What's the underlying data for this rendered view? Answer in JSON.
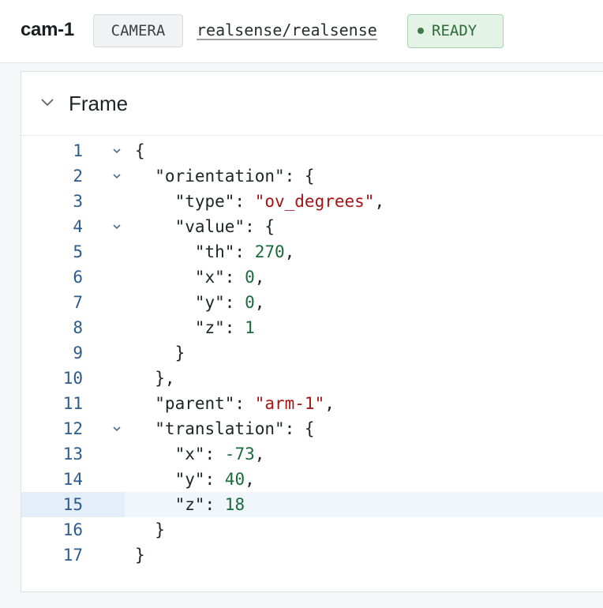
{
  "header": {
    "title": "cam-1",
    "type_label": "CAMERA",
    "model_label": "realsense/realsense",
    "status_label": "READY"
  },
  "panel": {
    "title": "Frame",
    "collapse_icon": "chevron-down-icon"
  },
  "colors": {
    "status_bg": "#e3f3e5",
    "status_text": "#2f6b3a",
    "line_number": "#2d5b8c",
    "string": "#a31515",
    "number": "#1a6b3c",
    "active_line": "#f0f6fc"
  },
  "editor": {
    "active_line": 15,
    "lines": [
      {
        "n": "1",
        "fold": true,
        "tokens": [
          {
            "t": "p",
            "v": "{"
          }
        ]
      },
      {
        "n": "2",
        "fold": true,
        "tokens": [
          {
            "t": "p",
            "v": "  \"orientation\": {"
          }
        ]
      },
      {
        "n": "3",
        "fold": false,
        "tokens": [
          {
            "t": "p",
            "v": "    \"type\": "
          },
          {
            "t": "s",
            "v": "\"ov_degrees\""
          },
          {
            "t": "p",
            "v": ","
          }
        ]
      },
      {
        "n": "4",
        "fold": true,
        "tokens": [
          {
            "t": "p",
            "v": "    \"value\": {"
          }
        ]
      },
      {
        "n": "5",
        "fold": false,
        "tokens": [
          {
            "t": "p",
            "v": "      \"th\": "
          },
          {
            "t": "n",
            "v": "270"
          },
          {
            "t": "p",
            "v": ","
          }
        ]
      },
      {
        "n": "6",
        "fold": false,
        "tokens": [
          {
            "t": "p",
            "v": "      \"x\": "
          },
          {
            "t": "n",
            "v": "0"
          },
          {
            "t": "p",
            "v": ","
          }
        ]
      },
      {
        "n": "7",
        "fold": false,
        "tokens": [
          {
            "t": "p",
            "v": "      \"y\": "
          },
          {
            "t": "n",
            "v": "0"
          },
          {
            "t": "p",
            "v": ","
          }
        ]
      },
      {
        "n": "8",
        "fold": false,
        "tokens": [
          {
            "t": "p",
            "v": "      \"z\": "
          },
          {
            "t": "n",
            "v": "1"
          }
        ]
      },
      {
        "n": "9",
        "fold": false,
        "tokens": [
          {
            "t": "p",
            "v": "    }"
          }
        ]
      },
      {
        "n": "10",
        "fold": false,
        "tokens": [
          {
            "t": "p",
            "v": "  },"
          }
        ]
      },
      {
        "n": "11",
        "fold": false,
        "tokens": [
          {
            "t": "p",
            "v": "  \"parent\": "
          },
          {
            "t": "s",
            "v": "\"arm-1\""
          },
          {
            "t": "p",
            "v": ","
          }
        ]
      },
      {
        "n": "12",
        "fold": true,
        "tokens": [
          {
            "t": "p",
            "v": "  \"translation\": {"
          }
        ]
      },
      {
        "n": "13",
        "fold": false,
        "tokens": [
          {
            "t": "p",
            "v": "    \"x\": "
          },
          {
            "t": "n",
            "v": "-73"
          },
          {
            "t": "p",
            "v": ","
          }
        ]
      },
      {
        "n": "14",
        "fold": false,
        "tokens": [
          {
            "t": "p",
            "v": "    \"y\": "
          },
          {
            "t": "n",
            "v": "40"
          },
          {
            "t": "p",
            "v": ","
          }
        ]
      },
      {
        "n": "15",
        "fold": false,
        "tokens": [
          {
            "t": "p",
            "v": "    \"z\": "
          },
          {
            "t": "n",
            "v": "18"
          }
        ]
      },
      {
        "n": "16",
        "fold": false,
        "tokens": [
          {
            "t": "p",
            "v": "  }"
          }
        ]
      },
      {
        "n": "17",
        "fold": false,
        "tokens": [
          {
            "t": "p",
            "v": "}"
          }
        ]
      }
    ]
  }
}
